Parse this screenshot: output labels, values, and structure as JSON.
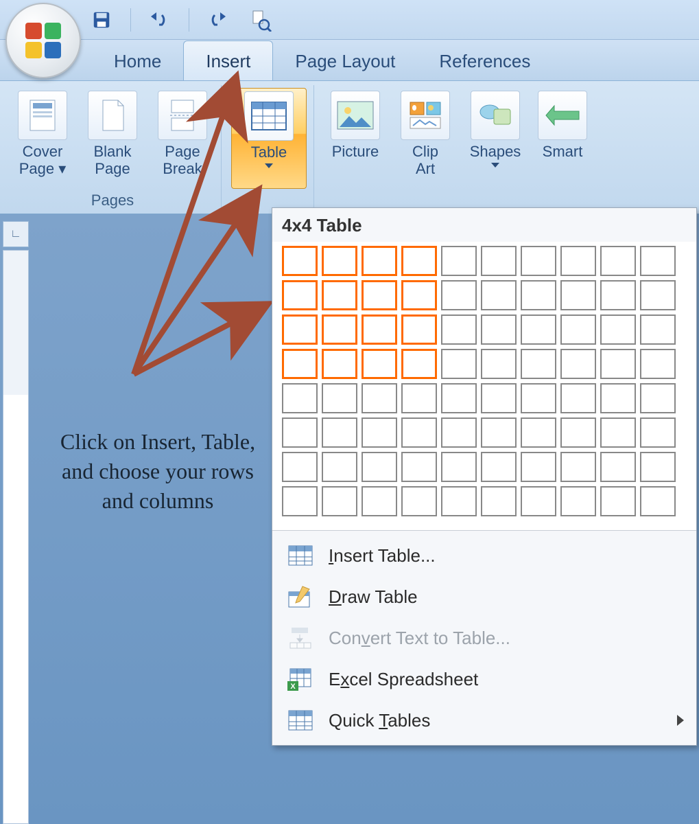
{
  "tabs": {
    "home": "Home",
    "insert": "Insert",
    "page_layout": "Page Layout",
    "references": "References"
  },
  "pages_group": {
    "label": "Pages",
    "cover": "Cover\nPage ▾",
    "blank": "Blank\nPage",
    "break": "Page\nBreak"
  },
  "tables_group": {
    "table": "Table"
  },
  "illus_group": {
    "picture": "Picture",
    "clipart": "Clip\nArt",
    "shapes": "Shapes",
    "smartart": "Smart"
  },
  "popup": {
    "title": "4x4 Table",
    "grid_cols": 10,
    "grid_rows": 8,
    "sel_cols": 4,
    "sel_rows": 4,
    "insert": "Insert Table...",
    "draw": "Draw Table",
    "convert": "Convert Text to Table...",
    "excel": "Excel Spreadsheet",
    "quick": "Quick Tables"
  },
  "annotation": "Click on Insert, Table, and choose your rows and columns",
  "corner_marker": "∟"
}
